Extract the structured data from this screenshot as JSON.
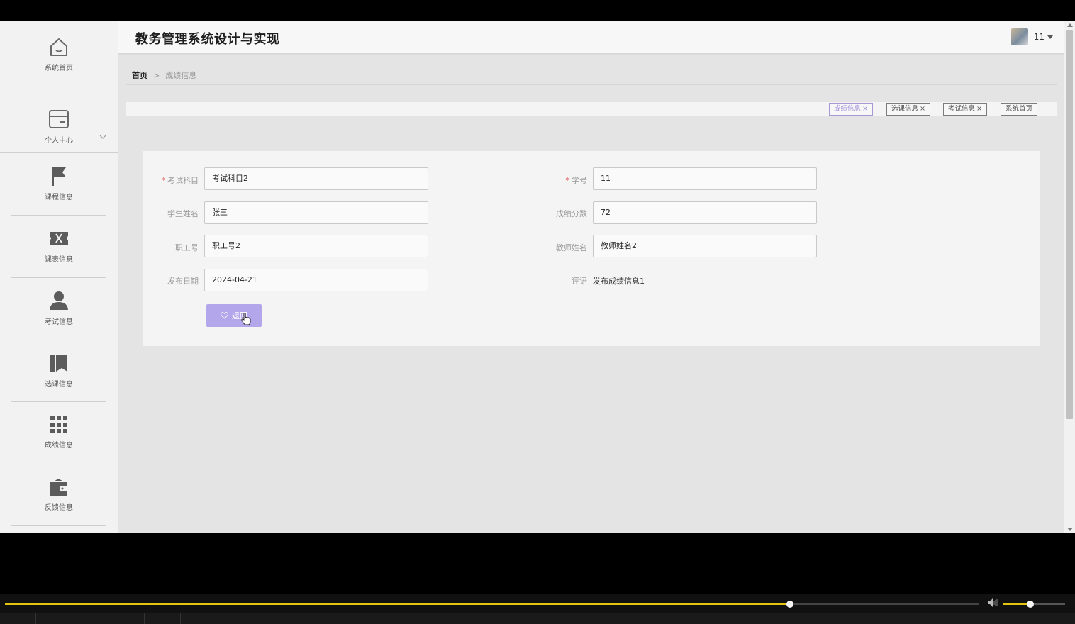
{
  "header": {
    "title": "教务管理系统设计与实现",
    "user_name": "11"
  },
  "sidebar": {
    "items": [
      {
        "label": "系统首页",
        "icon": "home-icon"
      },
      {
        "label": "个人中心",
        "icon": "card-icon"
      },
      {
        "label": "课程信息",
        "icon": "flag-icon"
      },
      {
        "label": "课表信息",
        "icon": "ticket-icon"
      },
      {
        "label": "考试信息",
        "icon": "user-icon"
      },
      {
        "label": "选课信息",
        "icon": "books-icon"
      },
      {
        "label": "成绩信息",
        "icon": "grid-icon"
      },
      {
        "label": "反馈信息",
        "icon": "wallet-icon"
      }
    ]
  },
  "breadcrumb": {
    "home": "首页",
    "separator": ">",
    "current": "成绩信息"
  },
  "tags": [
    {
      "label": "成绩信息",
      "closable": true,
      "active": true
    },
    {
      "label": "选课信息",
      "closable": true,
      "active": false
    },
    {
      "label": "考试信息",
      "closable": true,
      "active": false
    },
    {
      "label": "系统首页",
      "closable": false,
      "active": false
    }
  ],
  "tag_close": "×",
  "form": {
    "exam_subject": {
      "label": "考试科目",
      "value": "考试科目2",
      "required": true
    },
    "student_id": {
      "label": "学号",
      "value": "11",
      "required": true
    },
    "student_name": {
      "label": "学生姓名",
      "value": "张三"
    },
    "score": {
      "label": "成绩分数",
      "value": "72"
    },
    "staff_id": {
      "label": "职工号",
      "value": "职工号2"
    },
    "teacher_name": {
      "label": "教师姓名",
      "value": "教师姓名2"
    },
    "publish_date": {
      "label": "发布日期",
      "value": "2024-04-21"
    },
    "comment": {
      "label": "评语",
      "value": "发布成绩信息1"
    },
    "required_mark": "*",
    "return_button": "返回"
  },
  "player": {
    "progress": 0.806,
    "volume": 0.44
  },
  "colors": {
    "accent": "#b4a6ea",
    "seek": "#e3c512",
    "active_tag": "#a38fdb"
  }
}
